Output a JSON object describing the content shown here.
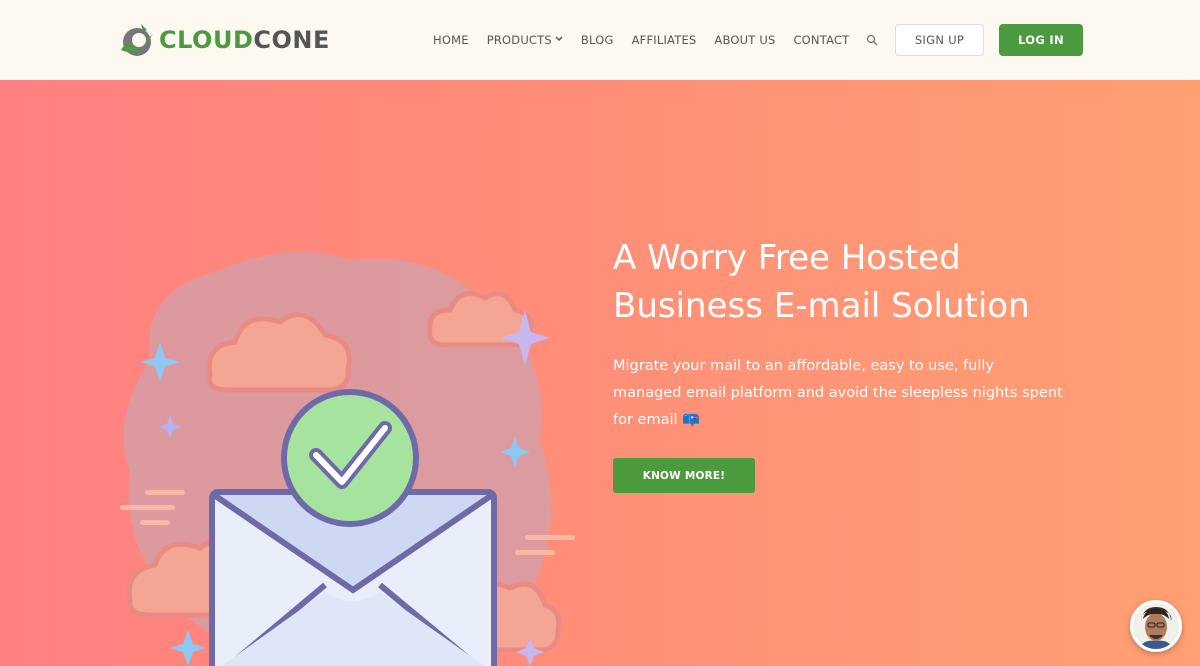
{
  "brand": {
    "name_prefix": "CLOUD",
    "name_suffix": "CONE"
  },
  "nav": {
    "items": [
      {
        "label": "HOME"
      },
      {
        "label": "PRODUCTS",
        "has_dropdown": true
      },
      {
        "label": "BLOG"
      },
      {
        "label": "AFFILIATES"
      },
      {
        "label": "ABOUT US"
      },
      {
        "label": "CONTACT"
      }
    ],
    "search_icon": "search-icon",
    "signup_label": "SIGN UP",
    "login_label": "LOG IN"
  },
  "hero": {
    "title_line1": "A Worry Free Hosted",
    "title_line2": "Business E-mail Solution",
    "subtitle_line1": "Migrate your mail to an affordable, easy to use, fully",
    "subtitle_line2": "managed email platform and avoid the sleepless nights spent",
    "subtitle_line3": "for email 📪",
    "cta_label": "KNOW MORE!"
  },
  "colors": {
    "accent_green": "#4b9a3d",
    "hero_gradient_start": "#ff8080",
    "hero_gradient_end": "#ff9f72",
    "header_bg": "#fdf9f1"
  },
  "icons": {
    "illustration": "envelope-check-icon",
    "chat": "chat-avatar"
  }
}
